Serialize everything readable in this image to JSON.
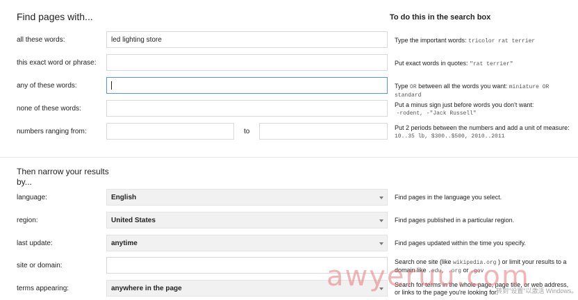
{
  "header": {
    "title": "Find pages with...",
    "side_title": "To do this in the search box"
  },
  "rows": [
    {
      "label": "all these words:",
      "value": "led lighting store",
      "help_text": "Type the important words:",
      "help_code": "tricolor rat terrier"
    },
    {
      "label": "this exact word or phrase:",
      "value": "",
      "help_text": "Put exact words in quotes:",
      "help_code": "\"rat terrier\""
    },
    {
      "label": "any of these words:",
      "value": "",
      "help_pre": "Type",
      "help_code_mid": "OR",
      "help_text": "between all the words you want:",
      "help_code": "miniature OR standard"
    },
    {
      "label": "none of these words:",
      "value": "",
      "help_text": "Put a minus sign just before words you don't want:",
      "help_code": "-rodent, -\"Jack Russell\""
    },
    {
      "label": "numbers ranging from:",
      "value_from": "",
      "to_label": "to",
      "value_to": "",
      "help_text": "Put 2 periods between the numbers and add a unit of measure:",
      "help_code": "10..35 lb, $300..$500, 2010..2011"
    }
  ],
  "narrow": {
    "title": "Then narrow your results by...",
    "rows": [
      {
        "label": "language:",
        "value": "English",
        "help_text": "Find pages in the language you select."
      },
      {
        "label": "region:",
        "value": "United States",
        "help_text": "Find pages published in a particular region."
      },
      {
        "label": "last update:",
        "value": "anytime",
        "help_text": "Find pages updated within the time you specify."
      },
      {
        "label": "site or domain:",
        "value": "",
        "help_pre": "Search one site (like",
        "help_code": "wikipedia.org",
        "help_mid": ") or limit your results to a domain like",
        "help_code2": ".edu, .org",
        "help_mid2": "or",
        "help_code3": ".gov"
      },
      {
        "label": "terms appearing:",
        "value": "anywhere in the page",
        "help_text": "Search for terms in the whole page, page title, or web address, or links to the page you're looking for."
      }
    ]
  },
  "overlay": {
    "watermark": "awyeruu.com",
    "windows_note": "转到\"设置\"以激活 Windows。"
  }
}
